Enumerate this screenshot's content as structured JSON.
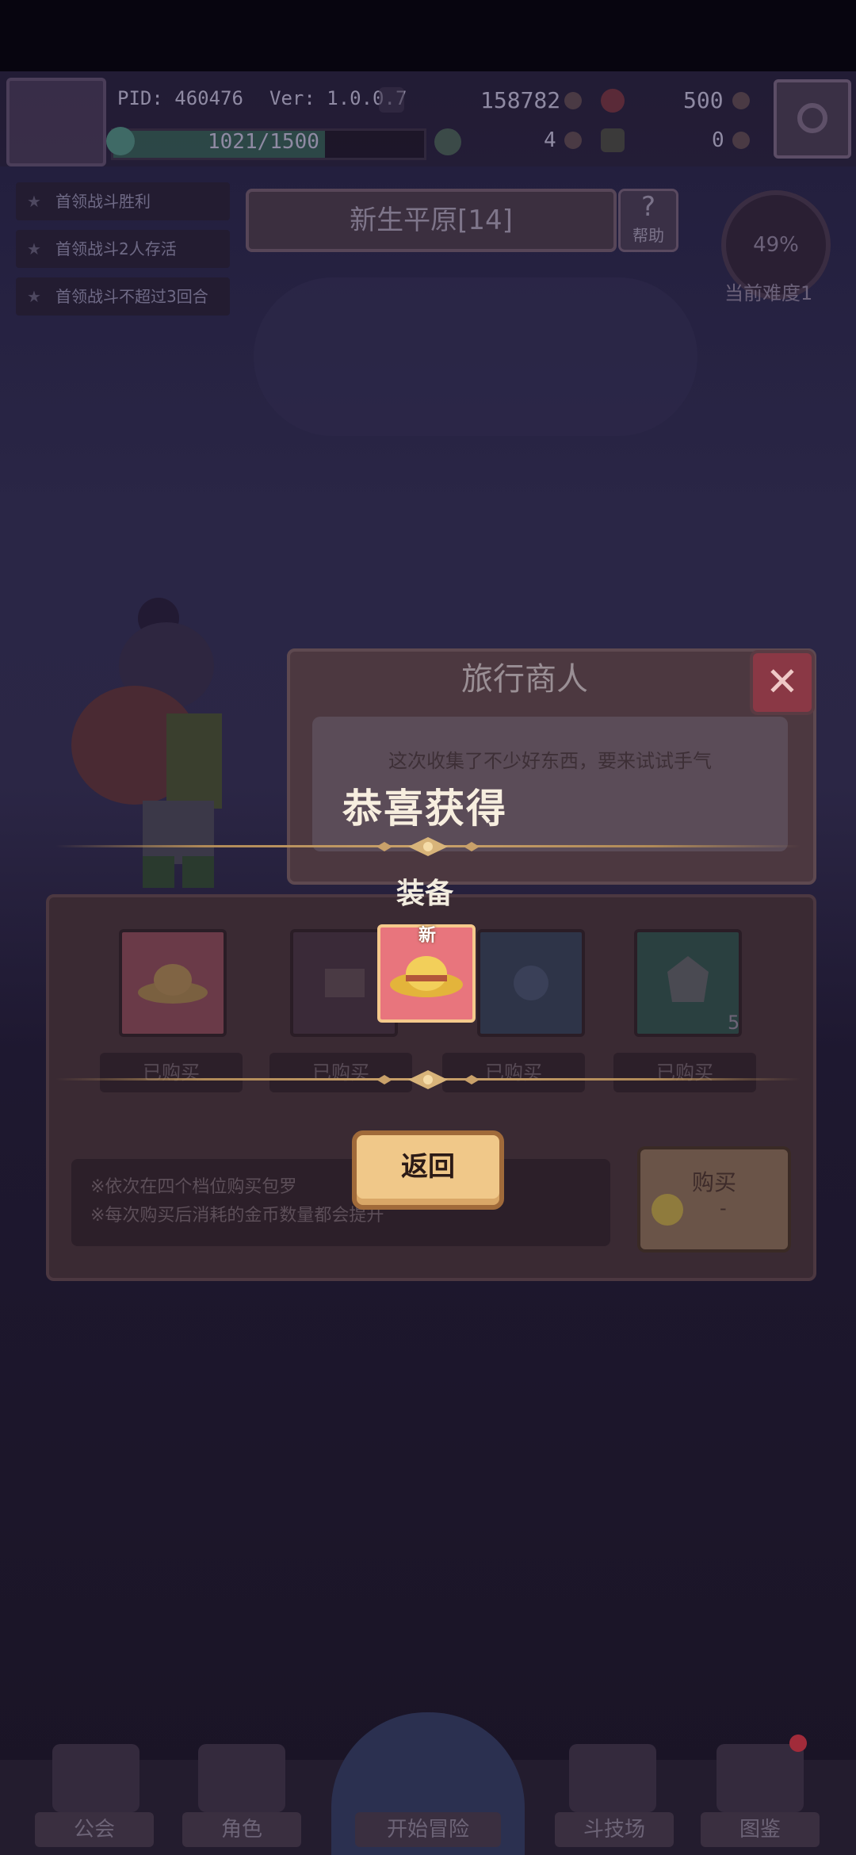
{
  "topbar": {
    "pid": "PID: 460476",
    "version": "Ver: 1.0.0.7",
    "xp": "1021/1500",
    "xp_fraction": 0.68,
    "gold": "158782",
    "gems": "500",
    "clover": "4",
    "keys": "0"
  },
  "quests": [
    "首领战斗胜利",
    "首领战斗2人存活",
    "首领战斗不超过3回合"
  ],
  "stage": {
    "name": "新生平原[14]",
    "help_label": "帮助",
    "difficulty_percent": "49%",
    "difficulty_label": "当前难度1"
  },
  "merchant": {
    "title": "旅行商人",
    "dialogue": "这次收集了不少好东西，要来试试手气",
    "close_icon": "close-icon"
  },
  "reward": {
    "congrats": "恭喜获得",
    "category": "装备",
    "new_tag": "新",
    "item_icon": "straw-hat-icon",
    "back_label": "返回"
  },
  "shop": {
    "slots": [
      {
        "label": "已购买",
        "icon": "straw-hat-icon"
      },
      {
        "label": "已购买",
        "icon": "ore-icon"
      },
      {
        "label": "已购买",
        "icon": "rune-icon"
      },
      {
        "label": "已购买",
        "icon": "crystal-icon",
        "count": "5"
      }
    ],
    "info_line1": "※依次在四个档位购买包罗",
    "info_line2": "※每次购买后消耗的金币数量都会提升",
    "buy_label": "购买",
    "buy_cost": "-"
  },
  "nav": {
    "items": [
      "公会",
      "角色",
      "开始冒险",
      "斗技场",
      "图鉴"
    ]
  },
  "colors": {
    "accent_gold": "#f0c889",
    "reward_bg": "#e8757d",
    "close_red": "#8a3845"
  }
}
